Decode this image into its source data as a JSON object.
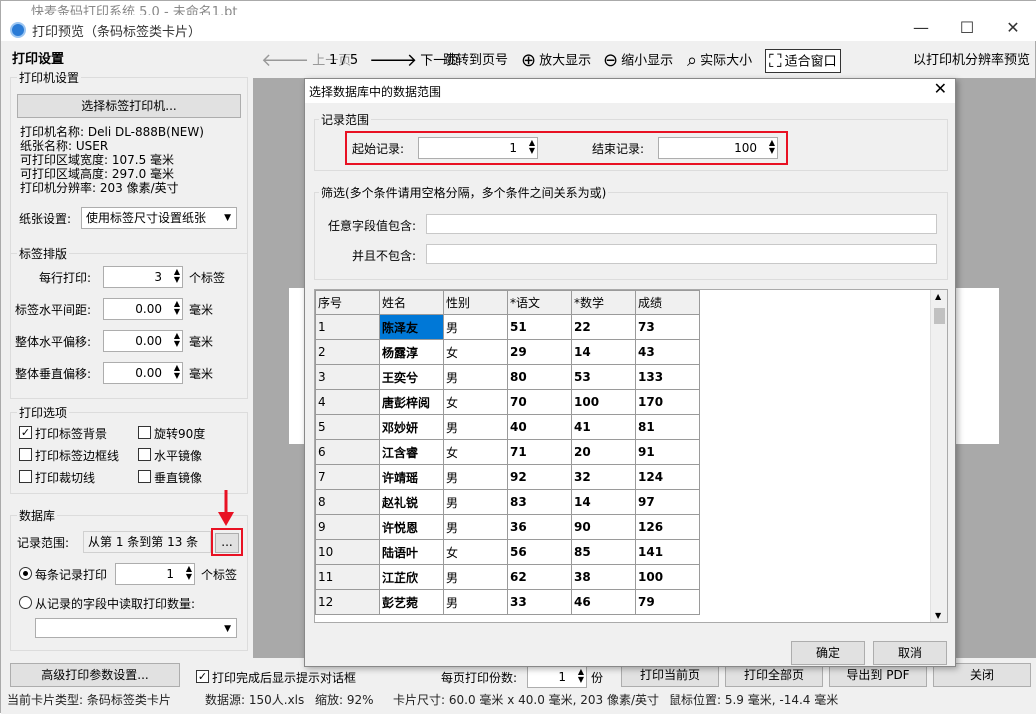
{
  "window": {
    "ghost_title": "快麦条码打印系统 5.0 - 未命名1.bt",
    "title": "打印预览（条码标签类卡片）",
    "minimize": "—",
    "maximize": "☐",
    "close": "✕"
  },
  "left": {
    "panel_title": "打印设置",
    "printer_group": "打印机设置",
    "select_printer_btn": "选择标签打印机...",
    "printer_name": "打印机名称: Deli DL-888B(NEW)",
    "paper_name": "纸张名称: USER",
    "print_width": "可打印区域宽度: 107.5 毫米",
    "print_height": "可打印区域高度: 297.0 毫米",
    "printer_resolution": "打印机分辨率: 203 像素/英寸",
    "paper_setting_label": "纸张设置:",
    "paper_setting_value": "使用标签尺寸设置纸张",
    "layout_group": "标签排版",
    "per_row_label": "每行打印:",
    "per_row_value": "3",
    "per_row_unit": "个标签",
    "hgap_label": "标签水平间距:",
    "hgap_value": "0.00",
    "hgap_unit": "毫米",
    "hoffset_label": "整体水平偏移:",
    "hoffset_value": "0.00",
    "hoffset_unit": "毫米",
    "voffset_label": "整体垂直偏移:",
    "voffset_value": "0.00",
    "voffset_unit": "毫米",
    "options_group": "打印选项",
    "opt_bg": "打印标签背景",
    "opt_rotate": "旋转90度",
    "opt_border": "打印标签边框线",
    "opt_hmirror": "水平镜像",
    "opt_cut": "打印裁切线",
    "opt_vmirror": "垂直镜像",
    "db_group": "数据库",
    "range_label": "记录范围:",
    "range_value": "从第 1 条到第 13 条",
    "range_btn": "...",
    "radio_each": "每条记录打印",
    "each_value": "1",
    "each_unit": "个标签",
    "radio_field": "从记录的字段中读取打印数量:"
  },
  "toolbar": {
    "prev": "上一页",
    "page": "1 / 5",
    "next": "下一页",
    "jump": "跳转到页号",
    "zoom_in": "放大显示",
    "zoom_out": "缩小显示",
    "actual": "实际大小",
    "fit": "适合窗口",
    "resolution": "以打印机分辨率预览"
  },
  "bottom": {
    "advanced_btn": "高级打印参数设置...",
    "show_dialog_label": "打印完成后显示提示对话框",
    "copies_label": "每页打印份数:",
    "copies_value": "1",
    "copies_unit": "份",
    "print_current": "打印当前页",
    "print_all": "打印全部页",
    "export_pdf": "导出到 PDF",
    "close": "关闭"
  },
  "status": {
    "card_type": "当前卡片类型: 条码标签类卡片",
    "datasource": "数据源: 150人.xls",
    "zoom": "缩放: 92%",
    "card_size": "卡片尺寸: 60.0 毫米 x 40.0 毫米, 203 像素/英寸",
    "mouse": "鼠标位置: 5.9 毫米, -14.4 毫米"
  },
  "dialog": {
    "title": "选择数据库中的数据范围",
    "close": "✕",
    "range_group": "记录范围",
    "start_label": "起始记录:",
    "start_value": "1",
    "end_label": "结束记录:",
    "end_value": "100",
    "filter_group": "筛选(多个条件请用空格分隔，多个条件之间关系为或)",
    "contains_label": "任意字段值包含:",
    "contains_value": "",
    "excludes_label": "并且不包含:",
    "excludes_value": "",
    "ok": "确定",
    "cancel": "取消",
    "columns": [
      "序号",
      "姓名",
      "性别",
      "*语文",
      "*数学",
      "成绩"
    ],
    "rows": [
      [
        "1",
        "陈泽友",
        "男",
        "51",
        "22",
        "73"
      ],
      [
        "2",
        "杨露淳",
        "女",
        "29",
        "14",
        "43"
      ],
      [
        "3",
        "王奕兮",
        "男",
        "80",
        "53",
        "133"
      ],
      [
        "4",
        "唐彭梓阅",
        "女",
        "70",
        "100",
        "170"
      ],
      [
        "5",
        "邓妙妍",
        "男",
        "40",
        "41",
        "81"
      ],
      [
        "6",
        "江含睿",
        "女",
        "71",
        "20",
        "91"
      ],
      [
        "7",
        "许靖瑶",
        "男",
        "92",
        "32",
        "124"
      ],
      [
        "8",
        "赵礼锐",
        "男",
        "83",
        "14",
        "97"
      ],
      [
        "9",
        "许悦恩",
        "男",
        "36",
        "90",
        "126"
      ],
      [
        "10",
        "陆语叶",
        "女",
        "56",
        "85",
        "141"
      ],
      [
        "11",
        "江芷欣",
        "男",
        "62",
        "38",
        "100"
      ],
      [
        "12",
        "彭艺菀",
        "男",
        "33",
        "46",
        "79"
      ]
    ]
  },
  "colors": {
    "accent": "#0078d7",
    "highlight": "#e81123"
  }
}
